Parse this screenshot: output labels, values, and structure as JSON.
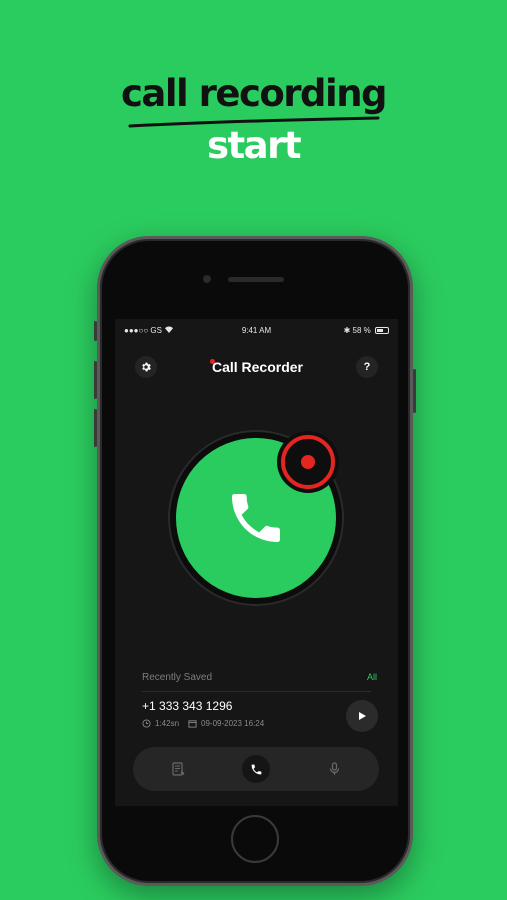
{
  "headline": {
    "line1": "call recording",
    "line2": "start"
  },
  "status_bar": {
    "carrier": "●●●○○ GS",
    "time": "9:41 AM",
    "battery": "58 %"
  },
  "app": {
    "title": "Call Recorder",
    "help": "?"
  },
  "recent": {
    "label": "Recently Saved",
    "all_link": "All",
    "items": [
      {
        "number": "+1 333 343 1296",
        "duration": "1:42sn",
        "datetime": "09-09-2023 16:24"
      }
    ]
  },
  "icons": {
    "settings": "gear-icon",
    "call": "phone-icon",
    "record": "record-icon",
    "play": "play-icon",
    "notes": "notes-icon",
    "mic": "mic-icon",
    "clock": "clock-icon",
    "calendar": "calendar-icon"
  },
  "colors": {
    "background": "#2bcc5f",
    "accent_green": "#2bcc5f",
    "record_red": "#e52620",
    "screen": "#161616"
  }
}
